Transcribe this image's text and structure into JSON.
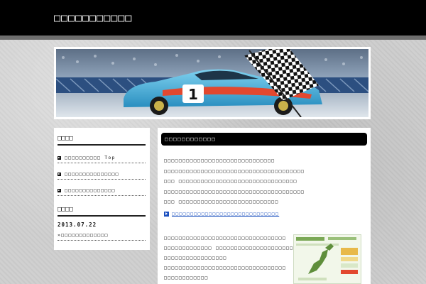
{
  "header": {
    "site_title": "□□□□□□□□□□□"
  },
  "sidebar": {
    "menu_heading": "□□□□",
    "menu_items": [
      {
        "label": "□□□□□□□□□□ Top"
      },
      {
        "label": "□□□□□□□□□□□□□□□"
      },
      {
        "label": "□□□□□□□□□□□□□□"
      }
    ],
    "archive_heading": "□□□□",
    "date": "2013.07.22",
    "post_link": "»□□□□□□□□□□□□□"
  },
  "main": {
    "heading": "□□□□□□□□□□□□",
    "paragraph1": [
      "□□□□□□□□□□□□□□□□□□□□□□□□□□□□□□",
      "□□□□□□□□□□□□□□□□□□□□□□□□□□□□□□□□□□□□□□",
      "□□□ □□□□□□□□□□□□□□□□□□□□□□□□□□□□□□□□",
      "□□□□□□□□□□□□□□□□□□□□□□□□□□□□□□□□□□□□□□",
      "□□□ □□□□□□□□□□□□□□□□□□□□□□□□□□□"
    ],
    "link_text": "□□□□□□□□□□□□□□□□□□□□□□□□□□□□□",
    "paragraph2": [
      "□□□□□□□□□□□□□□□□□□□□□□□□□□□□□□□□□",
      "□□□□□□□□□□□□□ □□□□□□□□□□□□□□□□□□□□□",
      "□□□□□□□□□□□□□□□□□",
      "□□□□□□□□□□□□□□□□□□□□□□□□□□□□□□□□□",
      "□□□□□□□□□□□□"
    ]
  },
  "colors": {
    "header_bg": "#000000",
    "link": "#1a4fbf",
    "car_body": "#3aa9d6",
    "car_accent": "#e2482f"
  }
}
